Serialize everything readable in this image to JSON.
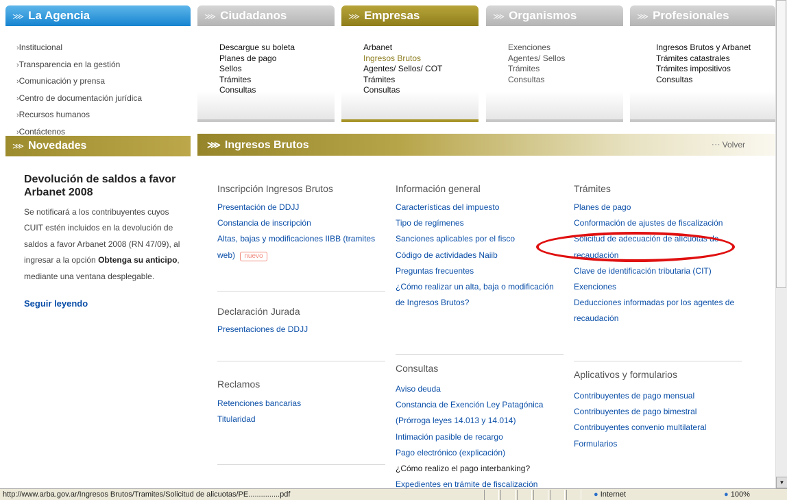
{
  "tabs": {
    "agencia": "La Agencia",
    "ciudadanos": "Ciudadanos",
    "empresas": "Empresas",
    "organismos": "Organismos",
    "profesionales": "Profesionales",
    "novedades": "Novedades"
  },
  "agencia_items": [
    "Institucional",
    "Transparencia en la gestión",
    "Comunicación y prensa",
    "Centro de documentación jurídica",
    "Recursos humanos",
    "Contáctenos"
  ],
  "ciudadanos_items": [
    "Descargue su boleta",
    "Planes de pago",
    "Sellos",
    "Trámites",
    "Consultas"
  ],
  "empresas_items": [
    "Arbanet",
    "Ingresos Brutos",
    "Agentes/ Sellos/ COT",
    "Trámites",
    "Consultas"
  ],
  "organismos_items": [
    "Exenciones",
    "Agentes/ Sellos",
    "Trámites",
    "Consultas"
  ],
  "profesionales_items": [
    "Ingresos Brutos y Arbanet",
    "Trámites catastrales",
    "Trámites impositivos",
    "Consultas"
  ],
  "novedades": {
    "title": "Devolución de saldos a favor Arbanet 2008",
    "text_a": "Se notificará a los contribuyentes cuyos CUIT estén incluidos en la devolución de saldos a favor Arbanet 2008 (RN 47/09), al ingresar a la opción ",
    "text_b": "Obtenga su anticipo",
    "text_c": ", mediante una ventana desplegable.",
    "more": "Seguir leyendo"
  },
  "ib": {
    "title": "Ingresos Brutos",
    "volver": "Volver",
    "nuevo": "nuevo"
  },
  "sections": {
    "inscripcion": {
      "title": "Inscripción Ingresos Brutos",
      "links": [
        "Presentación de DDJJ",
        "Constancia de inscripción",
        "Altas, bajas y modificaciones IIBB (tramites web)"
      ]
    },
    "declaracion": {
      "title": "Declaración Jurada",
      "links": [
        "Presentaciones de DDJJ"
      ]
    },
    "reclamos": {
      "title": "Reclamos",
      "links": [
        "Retenciones bancarias",
        "Titularidad"
      ]
    },
    "info": {
      "title": "Información general",
      "links": [
        "Características del impuesto",
        "Tipo de regímenes",
        "Sanciones aplicables por el fisco",
        "Código de actividades Naiib",
        "Preguntas frecuentes",
        "¿Cómo realizar un alta, baja o modificación de Ingresos Brutos?"
      ]
    },
    "consultas": {
      "title": "Consultas",
      "links": [
        "Aviso deuda",
        "Constancia de Exención Ley Patagónica (Prórroga leyes 14.013 y 14.014)",
        "Intimación pasible de recargo",
        "Pago electrónico (explicación)",
        "¿Cómo realizo el pago interbanking?",
        "Expedientes en trámite de fiscalización"
      ]
    },
    "tramites": {
      "title": "Trámites",
      "links": [
        "Planes de pago",
        "Conformación de ajustes de fiscalización",
        "Solicitud de adecuación de alícuotas de recaudación",
        "Clave de identificación tributaria (CIT)",
        "Exenciones",
        "Deducciones informadas por los agentes de recaudación"
      ]
    },
    "aplicativos": {
      "title": "Aplicativos y formularios",
      "links": [
        "Contribuyentes de pago mensual",
        "Contribuyentes de pago bimestral",
        "Contribuyentes convenio multilateral",
        "Formularios"
      ]
    }
  },
  "statusbar": {
    "url": "http://www.arba.gov.ar/Ingresos Brutos/Tramites/Solicitud de alicuotas/PE...............pdf",
    "zone": "Internet",
    "zoom": "100%"
  },
  "colors": {
    "agencia": "#1684d0",
    "empresas": "#8f7d1c",
    "links": "#0b4fa8",
    "highlight": "#e01010"
  }
}
